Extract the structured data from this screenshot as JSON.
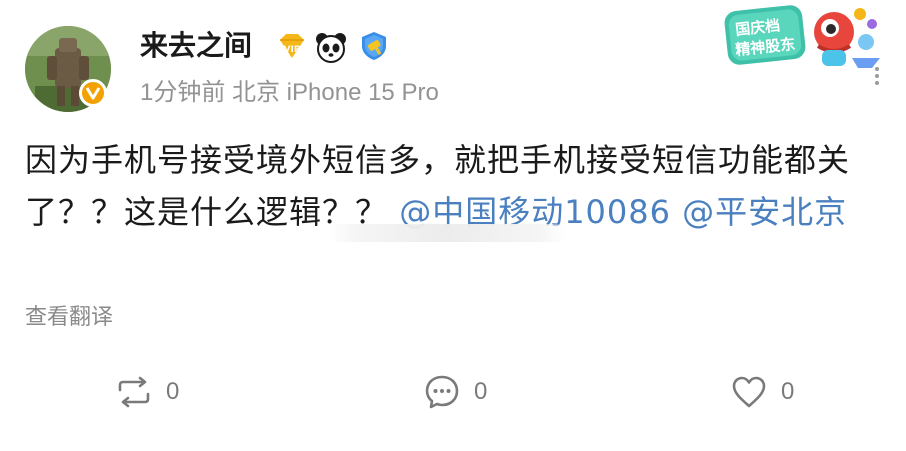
{
  "post": {
    "username": "来去之间",
    "meta": "1分钟前 北京 iPhone 15 Pro",
    "content_text": "因为手机号接受境外短信多，就把手机接受短信功能都关了？？这是什么逻辑？？",
    "mention_1": "@中国移动10086",
    "mention_2": "@平安北京",
    "translate_label": "查看翻译",
    "badges": [
      "vip-badge-icon",
      "panda-badge-icon",
      "shield-badge-icon"
    ]
  },
  "sticker": {
    "line1": "国庆档",
    "line2": "精神股东"
  },
  "actions": {
    "repost_count": "0",
    "comment_count": "0",
    "like_count": "0"
  },
  "colors": {
    "mention": "#4a7fc0",
    "meta": "#939393",
    "icon": "#7a7a7a"
  }
}
